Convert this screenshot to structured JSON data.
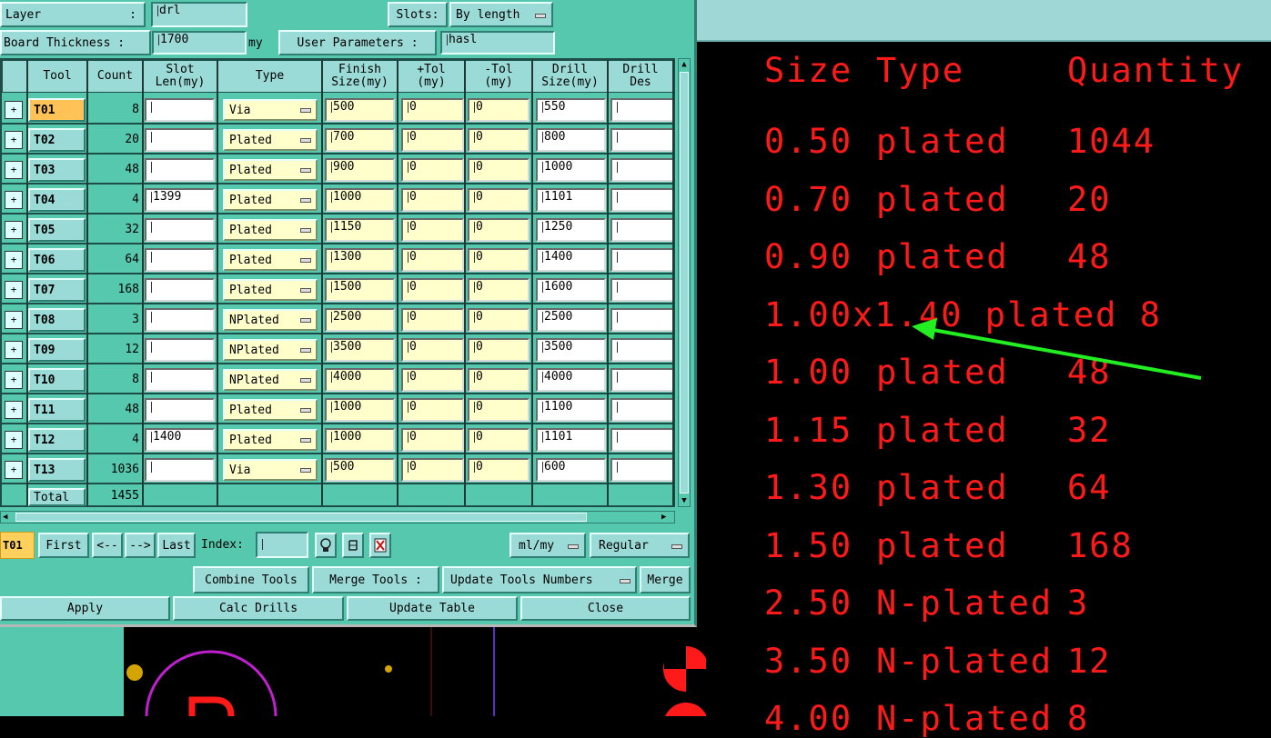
{
  "window": {
    "layer_label": "Layer",
    "layer_value": "drl",
    "slots_label": "Slots:",
    "slots_value": "By length",
    "thickness_label": "Board Thickness :",
    "thickness_value": "1700",
    "thickness_unit": "my",
    "user_params_label": "User Parameters :",
    "user_params_value": "hasl"
  },
  "table": {
    "headers": [
      "Tool",
      "Count",
      "Slot\nLen(my)",
      "Type",
      "Finish\nSize(my)",
      "+Tol\n(my)",
      "-Tol\n(my)",
      "Drill\nSize(my)",
      "Drill\nDes"
    ],
    "rows": [
      {
        "tool": "T01",
        "count": "8",
        "slot": "",
        "type": "Via",
        "finish": "500",
        "ptol": "0",
        "ntol": "0",
        "drill": "550",
        "des": ""
      },
      {
        "tool": "T02",
        "count": "20",
        "slot": "",
        "type": "Plated",
        "finish": "700",
        "ptol": "0",
        "ntol": "0",
        "drill": "800",
        "des": ""
      },
      {
        "tool": "T03",
        "count": "48",
        "slot": "",
        "type": "Plated",
        "finish": "900",
        "ptol": "0",
        "ntol": "0",
        "drill": "1000",
        "des": ""
      },
      {
        "tool": "T04",
        "count": "4",
        "slot": "1399",
        "type": "Plated",
        "finish": "1000",
        "ptol": "0",
        "ntol": "0",
        "drill": "1101",
        "des": ""
      },
      {
        "tool": "T05",
        "count": "32",
        "slot": "",
        "type": "Plated",
        "finish": "1150",
        "ptol": "0",
        "ntol": "0",
        "drill": "1250",
        "des": ""
      },
      {
        "tool": "T06",
        "count": "64",
        "slot": "",
        "type": "Plated",
        "finish": "1300",
        "ptol": "0",
        "ntol": "0",
        "drill": "1400",
        "des": ""
      },
      {
        "tool": "T07",
        "count": "168",
        "slot": "",
        "type": "Plated",
        "finish": "1500",
        "ptol": "0",
        "ntol": "0",
        "drill": "1600",
        "des": ""
      },
      {
        "tool": "T08",
        "count": "3",
        "slot": "",
        "type": "NPlated",
        "finish": "2500",
        "ptol": "0",
        "ntol": "0",
        "drill": "2500",
        "des": ""
      },
      {
        "tool": "T09",
        "count": "12",
        "slot": "",
        "type": "NPlated",
        "finish": "3500",
        "ptol": "0",
        "ntol": "0",
        "drill": "3500",
        "des": ""
      },
      {
        "tool": "T10",
        "count": "8",
        "slot": "",
        "type": "NPlated",
        "finish": "4000",
        "ptol": "0",
        "ntol": "0",
        "drill": "4000",
        "des": ""
      },
      {
        "tool": "T11",
        "count": "48",
        "slot": "",
        "type": "Plated",
        "finish": "1000",
        "ptol": "0",
        "ntol": "0",
        "drill": "1100",
        "des": ""
      },
      {
        "tool": "T12",
        "count": "4",
        "slot": "1400",
        "type": "Plated",
        "finish": "1000",
        "ptol": "0",
        "ntol": "0",
        "drill": "1101",
        "des": ""
      },
      {
        "tool": "T13",
        "count": "1036",
        "slot": "",
        "type": "Via",
        "finish": "500",
        "ptol": "0",
        "ntol": "0",
        "drill": "600",
        "des": ""
      }
    ],
    "total_label": "Total",
    "total_count": "1455"
  },
  "nav": {
    "current": "T01",
    "first": "First",
    "prev": "<--",
    "next": "-->",
    "last": "Last",
    "index_label": "Index:",
    "units": "ml/my",
    "mode": "Regular"
  },
  "actions": {
    "combine": "Combine Tools",
    "merge_label": "Merge Tools :",
    "merge_mode": "Update Tools Numbers",
    "merge": "Merge",
    "apply": "Apply",
    "calc": "Calc Drills",
    "update": "Update Table",
    "close": "Close"
  },
  "drill_report": {
    "headers": [
      "Size",
      "Type",
      "Quantity"
    ],
    "lines": [
      [
        "0.50",
        "plated",
        "1044"
      ],
      [
        "0.70",
        "plated",
        "20"
      ],
      [
        "0.90",
        "plated",
        "48"
      ],
      [
        "1.00x1.40",
        "plated",
        "8"
      ],
      [
        "1.00",
        "plated",
        "48"
      ],
      [
        "1.15",
        "plated",
        "32"
      ],
      [
        "1.30",
        "plated",
        "64"
      ],
      [
        "1.50",
        "plated",
        "168"
      ],
      [
        "2.50",
        "N-plated",
        "3"
      ],
      [
        "3.50",
        "N-plated",
        "12"
      ],
      [
        "4.00",
        "N-plated",
        "8"
      ]
    ]
  },
  "colors": {
    "teal": "#55c8ad",
    "button": "#9adbd7",
    "report_text": "#ff1a1a",
    "arrow": "#22ee22"
  }
}
